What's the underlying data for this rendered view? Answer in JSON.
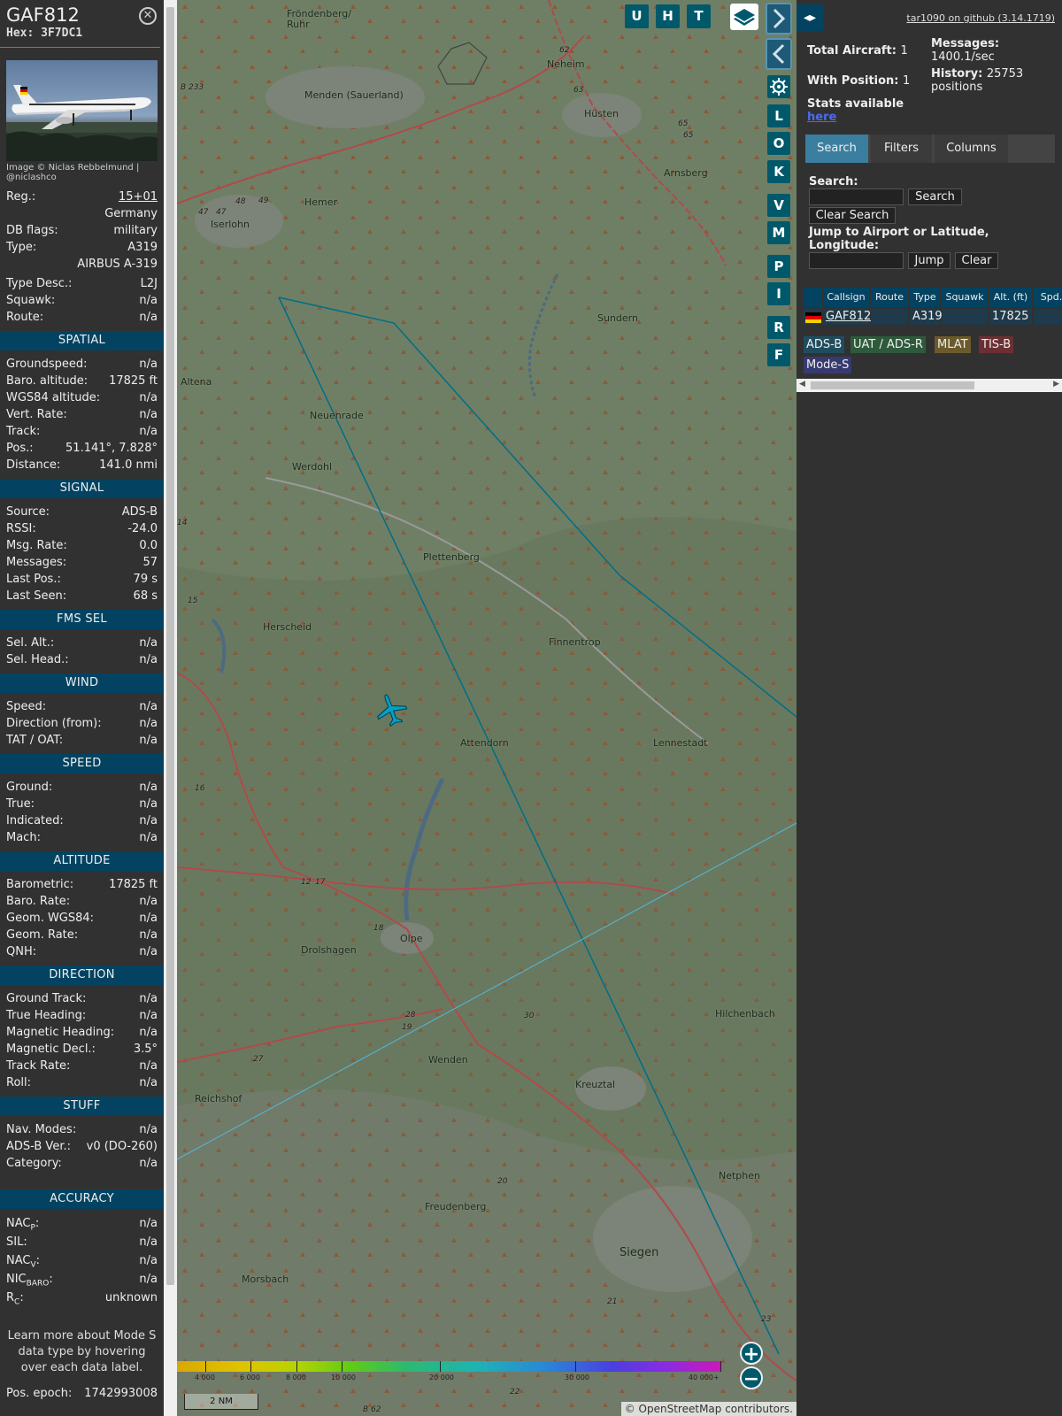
{
  "info": {
    "callsign": "GAF812",
    "hex_label": "Hex:",
    "hex": "3F7DC1",
    "close_icon": "close-circle-icon",
    "photo_credit": "Image © Niclas Rebbelmund | @niclashco",
    "rows": [
      {
        "k": "Reg.:",
        "v": "15+01"
      },
      {
        "k": "",
        "v": "Germany"
      },
      {
        "k": "DB flags:",
        "v": "military"
      },
      {
        "k": "Type:",
        "v": "A319"
      },
      {
        "k": "",
        "v": "AIRBUS A-319"
      },
      {
        "k": "Type Desc.:",
        "v": "L2J"
      },
      {
        "k": "Squawk:",
        "v": "n/a"
      },
      {
        "k": "Route:",
        "v": "n/a"
      }
    ],
    "sections": [
      {
        "title": "SPATIAL",
        "rows": [
          {
            "k": "Groundspeed:",
            "v": "n/a"
          },
          {
            "k": "Baro. altitude:",
            "v": "17825 ft"
          },
          {
            "k": "WGS84 altitude:",
            "v": "n/a"
          },
          {
            "k": "Vert. Rate:",
            "v": "n/a"
          },
          {
            "k": "Track:",
            "v": "n/a"
          },
          {
            "k": "Pos.:",
            "v": "51.141°, 7.828°"
          },
          {
            "k": "Distance:",
            "v": "141.0 nmi"
          }
        ]
      },
      {
        "title": "SIGNAL",
        "rows": [
          {
            "k": "Source:",
            "v": "ADS-B"
          },
          {
            "k": "RSSI:",
            "v": "-24.0"
          },
          {
            "k": "Msg. Rate:",
            "v": "0.0"
          },
          {
            "k": "Messages:",
            "v": "57"
          },
          {
            "k": "Last Pos.:",
            "v": "79 s"
          },
          {
            "k": "Last Seen:",
            "v": "68 s"
          }
        ]
      },
      {
        "title": "FMS SEL",
        "rows": [
          {
            "k": "Sel. Alt.:",
            "v": "n/a"
          },
          {
            "k": "Sel. Head.:",
            "v": "n/a"
          }
        ]
      },
      {
        "title": "WIND",
        "rows": [
          {
            "k": "Speed:",
            "v": "n/a"
          },
          {
            "k": "Direction (from):",
            "v": "n/a"
          },
          {
            "k": "TAT / OAT:",
            "v": "n/a"
          }
        ]
      },
      {
        "title": "SPEED",
        "rows": [
          {
            "k": "Ground:",
            "v": "n/a"
          },
          {
            "k": "True:",
            "v": "n/a"
          },
          {
            "k": "Indicated:",
            "v": "n/a"
          },
          {
            "k": "Mach:",
            "v": "n/a"
          }
        ]
      },
      {
        "title": "ALTITUDE",
        "rows": [
          {
            "k": "Barometric:",
            "v": "17825 ft"
          },
          {
            "k": "Baro. Rate:",
            "v": "n/a"
          },
          {
            "k": "Geom. WGS84:",
            "v": "n/a"
          },
          {
            "k": "Geom. Rate:",
            "v": "n/a"
          },
          {
            "k": "QNH:",
            "v": "n/a"
          }
        ]
      },
      {
        "title": "DIRECTION",
        "rows": [
          {
            "k": "Ground Track:",
            "v": "n/a"
          },
          {
            "k": "True Heading:",
            "v": "n/a"
          },
          {
            "k": "Magnetic Heading:",
            "v": "n/a"
          },
          {
            "k": "Magnetic Decl.:",
            "v": "3.5°"
          },
          {
            "k": "Track Rate:",
            "v": "n/a"
          },
          {
            "k": "Roll:",
            "v": "n/a"
          }
        ]
      },
      {
        "title": "STUFF",
        "rows": [
          {
            "k": "Nav. Modes:",
            "v": "n/a"
          },
          {
            "k": "ADS-B Ver.:",
            "v": "v0 (DO-260)"
          },
          {
            "k": "Category:",
            "v": "n/a"
          }
        ]
      }
    ],
    "accuracy_title": "ACCURACY",
    "accuracy": [
      {
        "k": "NAC",
        "sub": "P",
        "v": "n/a"
      },
      {
        "k": "SIL:",
        "sub": "",
        "v": "n/a"
      },
      {
        "k": "NAC",
        "sub": "V",
        "v": "n/a"
      },
      {
        "k": "NIC",
        "sub": "BARO",
        "v": "n/a"
      },
      {
        "k": "R",
        "sub": "C",
        "v": "unknown"
      }
    ],
    "learn_more": "Learn more about Mode S data type by hovering over each data label.",
    "pos_epoch_label": "Pos. epoch:",
    "pos_epoch": "1742993008"
  },
  "map": {
    "top_buttons": [
      "U",
      "H",
      "T"
    ],
    "side_buttons": [
      "L",
      "O",
      "K",
      "V",
      "M",
      "P",
      "I",
      "R",
      "F"
    ],
    "icons": {
      "layers": "layers-icon",
      "forward": "chevron-right-icon",
      "back": "chevron-left-icon",
      "settings": "gear-icon",
      "aircraft": "airplane-icon",
      "zoom_in": "plus-icon",
      "zoom_out": "minus-icon"
    },
    "towns": [
      {
        "name": "Fröndenberg/\nRuhr",
        "big": false
      },
      {
        "name": "Neheim",
        "big": false
      },
      {
        "name": "Menden (Sauerland)",
        "big": false
      },
      {
        "name": "Hüsten",
        "big": false
      },
      {
        "name": "Hemer",
        "big": false
      },
      {
        "name": "Arnsberg",
        "big": false
      },
      {
        "name": "Iserlohn",
        "big": false
      },
      {
        "name": "Sundern",
        "big": false
      },
      {
        "name": "Altena",
        "big": false
      },
      {
        "name": "Neuenrade",
        "big": false
      },
      {
        "name": "Werdohl",
        "big": false
      },
      {
        "name": "Plettenberg",
        "big": false
      },
      {
        "name": "Herscheid",
        "big": false
      },
      {
        "name": "Finnentrop",
        "big": false
      },
      {
        "name": "Attendorn",
        "big": false
      },
      {
        "name": "Lennestadt",
        "big": false
      },
      {
        "name": "Olpe",
        "big": false
      },
      {
        "name": "Drolshagen",
        "big": false
      },
      {
        "name": "Hilchenbach",
        "big": false
      },
      {
        "name": "Wenden",
        "big": false
      },
      {
        "name": "Kreuztal",
        "big": false
      },
      {
        "name": "Reichshof",
        "big": false
      },
      {
        "name": "Netphen",
        "big": false
      },
      {
        "name": "Freudenberg",
        "big": false
      },
      {
        "name": "Siegen",
        "big": true
      },
      {
        "name": "Morsbach",
        "big": false
      }
    ],
    "road_labels": [
      "B 233",
      "B 62",
      "62",
      "63",
      "65",
      "65",
      "48",
      "49",
      "47",
      "47",
      "15",
      "16",
      "17",
      "12",
      "18",
      "28",
      "19",
      "30",
      "27",
      "20",
      "21",
      "23",
      "22",
      "14"
    ],
    "altitude_scale": [
      "4 000",
      "6 000",
      "8 000",
      "10 000",
      "20 000",
      "30 000",
      "40 000+"
    ],
    "scale_label": "2 NM",
    "attribution": "© OpenStreetMap contributors."
  },
  "panel": {
    "github_link": "tar1090 on github (3.14.1719)",
    "total_aircraft_label": "Total Aircraft:",
    "total_aircraft": "1",
    "with_position_label": "With Position:",
    "with_position": "1",
    "messages_label": "Messages:",
    "messages_value": "1400.1/sec",
    "history_label": "History:",
    "history_value": "25753",
    "history_unit": "positions",
    "stats_label": "Stats available",
    "stats_link": "here",
    "tabs": [
      "Search",
      "Filters",
      "Columns"
    ],
    "search_label": "Search:",
    "search_button": "Search",
    "clear_search_button": "Clear Search",
    "jump_label": "Jump to Airport or Latitude, Longitude:",
    "jump_button": "Jump",
    "clear_button": "Clear",
    "columns": [
      "Callsign",
      "Route",
      "Type",
      "Squawk",
      "Alt. (ft)",
      "Spd."
    ],
    "rows": [
      {
        "flag": "flag-germany-icon",
        "callsign": "GAF812",
        "route": "",
        "type": "A319",
        "squawk": "",
        "alt": "17825",
        "spd": ""
      }
    ],
    "source_chips": [
      {
        "label": "ADS-B",
        "color": "#1f4d5e"
      },
      {
        "label": "UAT / ADS-R",
        "color": "#2d5a3b"
      },
      {
        "label": "MLAT",
        "color": "#6b5a2a"
      },
      {
        "label": "TIS-B",
        "color": "#6b2f33"
      },
      {
        "label": "Mode-S",
        "color": "#373a70"
      }
    ]
  }
}
